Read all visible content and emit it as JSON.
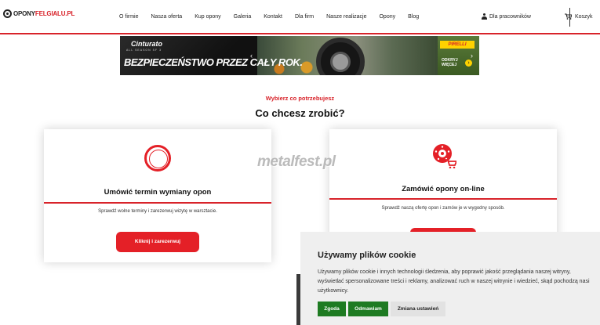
{
  "header": {
    "logo": {
      "part1": "OPONY",
      "part2": "FELGIALU.PL"
    },
    "nav": [
      "O firmie",
      "Nasza oferta",
      "Kup opony",
      "Galeria",
      "Kontakt",
      "Dla firm",
      "Nasze realizacje",
      "Opony",
      "Blog"
    ],
    "staff_label": "Dla pracowników",
    "cart_label": "Koszyk"
  },
  "banner": {
    "model": "Cinturato",
    "model_sub": "ALL SEASON SF 3",
    "headline": "BEZPIECZEŃSTWO PRZEZ CAŁY ROK.",
    "brand": "PIRELLI",
    "more_line1": "ODKRYJ",
    "more_line2": "WIĘCEJ"
  },
  "section": {
    "eyebrow": "Wybierz co potrzebujesz",
    "title": "Co chcesz zrobić?"
  },
  "cards": [
    {
      "title": "Umówić termin wymiany opon",
      "desc": "Sprawdź wolne terminy i zarezerwuj wizytę w warsztacie.",
      "button": "Kliknij i zarezerwuj"
    },
    {
      "title": "Zamówić opony on-line",
      "desc": "Sprawdź naszą ofertę opon i zamów je w wygodny sposób."
    }
  ],
  "watermark": "metalfest.pl",
  "cookie": {
    "title": "Używamy plików cookie",
    "text": "Używamy plików cookie i innych technologii śledzenia, aby poprawić jakość przeglądania naszej witryny, wyświetlać spersonalizowane treści i reklamy, analizować ruch w naszej witrynie i wiedzieć, skąd pochodzą nasi użytkownicy.",
    "accept": "Zgoda",
    "decline": "Odmawiam",
    "settings": "Zmiana ustawień"
  },
  "colors": {
    "accent": "#d8232a",
    "button_red": "#e42027",
    "cookie_green": "#1e7b22"
  }
}
